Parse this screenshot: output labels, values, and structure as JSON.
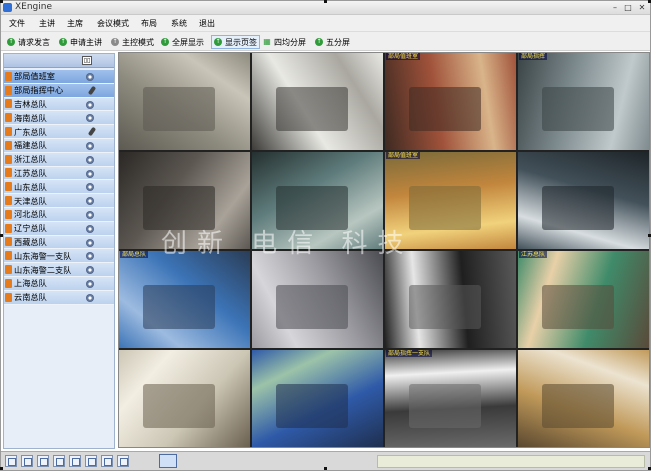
{
  "window": {
    "title": "XEngine",
    "minimize": "–",
    "maximize": "□",
    "close": "✕"
  },
  "menu": [
    "文件",
    "主讲",
    "主席",
    "会议模式",
    "布局",
    "系统",
    "退出"
  ],
  "toolbar": [
    {
      "label": "请求发言",
      "icon": "green-circle-icon",
      "active": false
    },
    {
      "label": "申请主讲",
      "icon": "green-circle-icon",
      "active": false
    },
    {
      "label": "主控模式",
      "icon": "gray-circle-icon",
      "active": false
    },
    {
      "label": "全屏显示",
      "icon": "green-circle-icon",
      "active": false
    },
    {
      "label": "显示页签",
      "icon": "green-circle-icon",
      "active": true
    },
    {
      "label": "四均分屏",
      "icon": "grid-icon",
      "active": false
    },
    {
      "label": "五分屏",
      "icon": "green-circle-icon",
      "active": false
    }
  ],
  "sidebar": {
    "items": [
      {
        "label": "部局值班室",
        "flag": true,
        "mic": false,
        "selected": true
      },
      {
        "label": "部局指挥中心",
        "flag": true,
        "mic": true,
        "selected": true
      },
      {
        "label": "吉林总队",
        "flag": true,
        "mic": false,
        "selected": false
      },
      {
        "label": "海南总队",
        "flag": true,
        "mic": false,
        "selected": false
      },
      {
        "label": "广东总队",
        "flag": true,
        "mic": true,
        "selected": false
      },
      {
        "label": "福建总队",
        "flag": true,
        "mic": false,
        "selected": false
      },
      {
        "label": "浙江总队",
        "flag": true,
        "mic": false,
        "selected": false
      },
      {
        "label": "江苏总队",
        "flag": true,
        "mic": false,
        "selected": false
      },
      {
        "label": "山东总队",
        "flag": true,
        "mic": false,
        "selected": false
      },
      {
        "label": "天津总队",
        "flag": true,
        "mic": false,
        "selected": false
      },
      {
        "label": "河北总队",
        "flag": true,
        "mic": false,
        "selected": false
      },
      {
        "label": "辽宁总队",
        "flag": true,
        "mic": false,
        "selected": false
      },
      {
        "label": "西藏总队",
        "flag": true,
        "mic": false,
        "selected": false
      },
      {
        "label": "山东海警一支队",
        "flag": true,
        "mic": false,
        "selected": false
      },
      {
        "label": "山东海警二支队",
        "flag": true,
        "mic": false,
        "selected": false
      },
      {
        "label": "上海总队",
        "flag": true,
        "mic": false,
        "selected": false
      },
      {
        "label": "云南总队",
        "flag": true,
        "mic": false,
        "selected": false
      }
    ]
  },
  "video_tiles": [
    {
      "label": "",
      "colors": [
        "#8d8a7e",
        "#c9c5b8",
        "#5d5a52"
      ]
    },
    {
      "label": "",
      "colors": [
        "#e9e9e4",
        "#a9a7a0",
        "#3c3b37"
      ]
    },
    {
      "label": "部局值班室",
      "colors": [
        "#a0523a",
        "#d9b48a",
        "#3e2a22"
      ]
    },
    {
      "label": "部局指挥",
      "colors": [
        "#7e8b8f",
        "#c0c9cb",
        "#3a4446"
      ]
    },
    {
      "label": "",
      "colors": [
        "#5c5751",
        "#a8a299",
        "#2b2825"
      ]
    },
    {
      "label": "",
      "colors": [
        "#5f7c7c",
        "#b8c6c0",
        "#24302f"
      ]
    },
    {
      "label": "部局值班室",
      "colors": [
        "#c2863d",
        "#f1d27c",
        "#7a6a3a"
      ]
    },
    {
      "label": "",
      "colors": [
        "#43515a",
        "#d7dde0",
        "#1e2529"
      ]
    },
    {
      "label": "部局总队",
      "colors": [
        "#3c74b7",
        "#9dbbe0",
        "#2a3d57"
      ]
    },
    {
      "label": "",
      "colors": [
        "#9a9aa0",
        "#d6d6da",
        "#4b4b52"
      ]
    },
    {
      "label": "",
      "colors": [
        "#1f1f1f",
        "#e6e6e6",
        "#5a5a5a"
      ]
    },
    {
      "label": "江苏总队",
      "colors": [
        "#3f8b6a",
        "#e8d0a8",
        "#5a4a3a"
      ]
    },
    {
      "label": "",
      "colors": [
        "#ccc6b5",
        "#f2eee2",
        "#6a604f"
      ]
    },
    {
      "label": "",
      "colors": [
        "#2f5aa8",
        "#9cc3a8",
        "#1f2f4f"
      ]
    },
    {
      "label": "部局指挥一支队",
      "colors": [
        "#3a3a3a",
        "#f0f0f0",
        "#6a6a6a"
      ]
    },
    {
      "label": "",
      "colors": [
        "#c19a5a",
        "#ece3d0",
        "#5a4830"
      ]
    }
  ],
  "watermark": "创新 电信 科技"
}
